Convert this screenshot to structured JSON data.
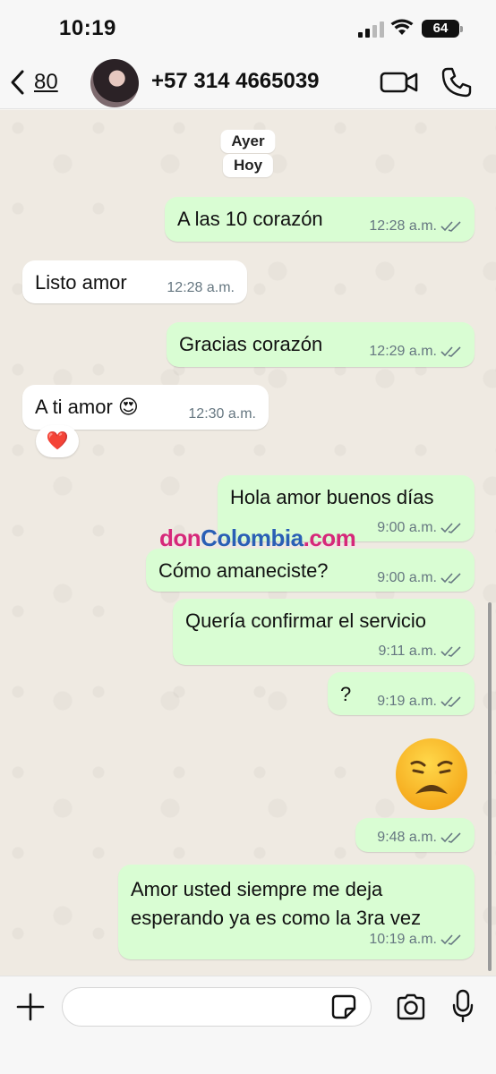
{
  "status_bar": {
    "time": "10:19",
    "battery": "64"
  },
  "header": {
    "back_count": "80",
    "contact_name": "+57 314 4665039"
  },
  "chat": {
    "date_labels": [
      "Ayer",
      "Hoy"
    ],
    "messages": [
      {
        "direction": "out",
        "text": "A las 10 corazón",
        "time": "12:28 a.m.",
        "read": true
      },
      {
        "direction": "in",
        "text": "Listo amor",
        "time": "12:28 a.m."
      },
      {
        "direction": "out",
        "text": "Gracias corazón",
        "time": "12:29 a.m.",
        "read": true
      },
      {
        "direction": "in",
        "text": "A ti amor 😍",
        "time": "12:30 a.m.",
        "reaction": "❤️"
      },
      {
        "direction": "out",
        "text": "Hola amor buenos días",
        "time": "9:00 a.m.",
        "read": true
      },
      {
        "direction": "out",
        "text": "Cómo amaneciste?",
        "time": "9:00 a.m.",
        "read": true
      },
      {
        "direction": "out",
        "text": "Quería confirmar el servicio",
        "time": "9:11 a.m.",
        "read": true
      },
      {
        "direction": "out",
        "text": "?",
        "time": "9:19 a.m.",
        "read": true
      },
      {
        "direction": "out",
        "emoji": "😩",
        "time": "9:48 a.m.",
        "read": true
      },
      {
        "direction": "out",
        "text_lines": [
          "Amor usted siempre me deja",
          "esperando ya es como la 3ra vez"
        ],
        "time": "10:19 a.m.",
        "read": true
      }
    ]
  },
  "watermark": {
    "part1": "don",
    "part2": "Colombia",
    "part3": ".com"
  },
  "input": {
    "placeholder": ""
  },
  "colors": {
    "outgoing": "#d9fdd3",
    "incoming": "#ffffff",
    "tick": "#667781"
  }
}
